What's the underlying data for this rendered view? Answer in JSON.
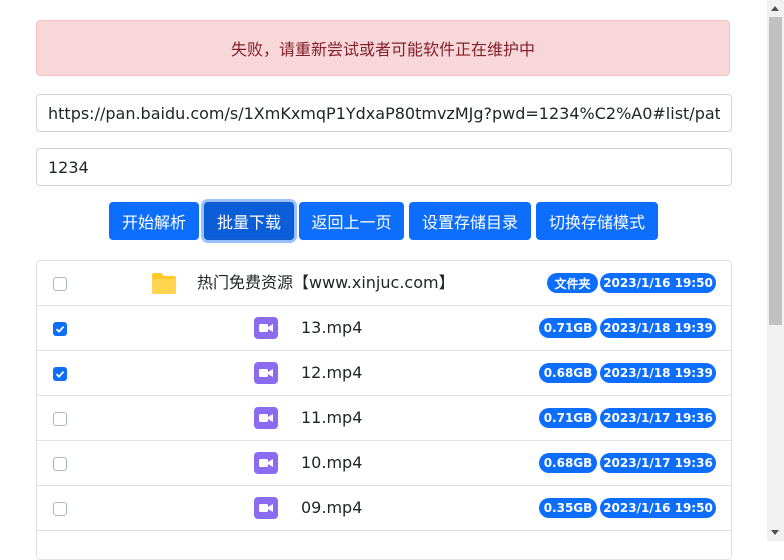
{
  "alert": {
    "message": "失败，请重新尝试或者可能软件正在维护中"
  },
  "url_input": {
    "value": "https://pan.baidu.com/s/1XmKxmqP1YdxaP80tmvzMJg?pwd=1234%C2%A0#list/path=%"
  },
  "password_input": {
    "value": "1234"
  },
  "buttons": {
    "start": "开始解析",
    "batch_download": "批量下载",
    "back": "返回上一页",
    "set_dir": "设置存储目录",
    "switch_mode": "切换存储模式"
  },
  "files": [
    {
      "name": "热门免费资源【www.xinjuc.com】",
      "type": "folder",
      "size": "文件夹",
      "date": "2023/1/16 19:50",
      "checked": false
    },
    {
      "name": "13.mp4",
      "type": "video",
      "size": "0.71GB",
      "date": "2023/1/18 19:39",
      "checked": true
    },
    {
      "name": "12.mp4",
      "type": "video",
      "size": "0.68GB",
      "date": "2023/1/18 19:39",
      "checked": true
    },
    {
      "name": "11.mp4",
      "type": "video",
      "size": "0.71GB",
      "date": "2023/1/17 19:36",
      "checked": false
    },
    {
      "name": "10.mp4",
      "type": "video",
      "size": "0.68GB",
      "date": "2023/1/17 19:36",
      "checked": false
    },
    {
      "name": "09.mp4",
      "type": "video",
      "size": "0.35GB",
      "date": "2023/1/16 19:50",
      "checked": false
    }
  ],
  "colors": {
    "primary": "#0d6efd",
    "alert_bg": "#f8d7da",
    "alert_text": "#842029",
    "folder": "#ffd54f",
    "video": "#8b6cf1"
  }
}
